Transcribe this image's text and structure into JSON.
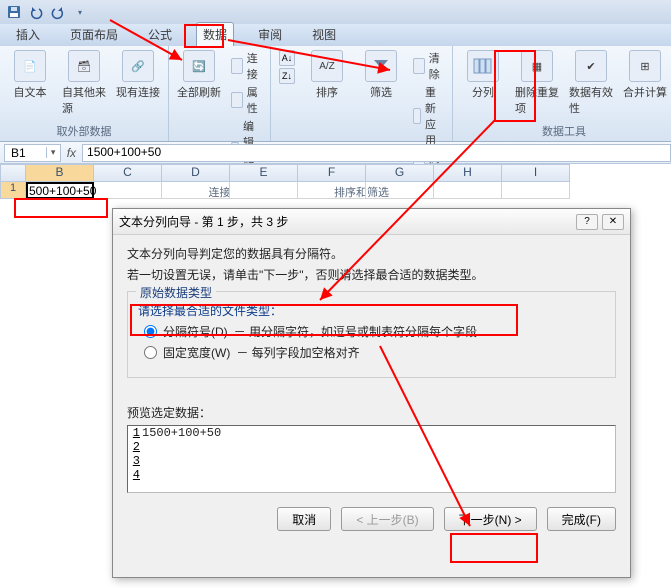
{
  "qat": {
    "save": "save",
    "undo": "undo",
    "redo": "redo"
  },
  "tabs": {
    "insert": "插入",
    "layout": "页面布局",
    "formulas": "公式",
    "data": "数据",
    "review": "审阅",
    "view": "视图"
  },
  "ribbon": {
    "ext": {
      "fromText": "自文本",
      "fromOther": "自其他来源",
      "existing": "现有连接",
      "title": "取外部数据"
    },
    "conn": {
      "refresh": "全部刷新",
      "connections": "连接",
      "properties": "属性",
      "editLinks": "编辑链接",
      "title": "连接"
    },
    "sort": {
      "sort": "排序",
      "filter": "筛选",
      "clear": "清除",
      "reapply": "重新应用",
      "advanced": "高级",
      "title": "排序和筛选"
    },
    "tools": {
      "textcol": "分列",
      "rmdup": "删除重复项",
      "validation": "数据有效性",
      "consolidate": "合并计算",
      "title": "数据工具"
    }
  },
  "namebox": "B1",
  "formula": "1500+100+50",
  "cols": [
    "B",
    "C",
    "D",
    "E",
    "F",
    "G",
    "H",
    "I"
  ],
  "row1": "1",
  "cellB1": "500+100+50",
  "dialog": {
    "title": "文本分列向导 - 第 1 步，共 3 步",
    "line1": "文本分列向导判定您的数据具有分隔符。",
    "line2": "若一切设置无误，请单击\"下一步\"，否则请选择最合适的数据类型。",
    "legend": "原始数据类型",
    "prompt": "请选择最合适的文件类型：",
    "opt1": "分隔符号(D)",
    "opt1desc": "－ 用分隔字符，如逗号或制表符分隔每个字段",
    "opt2": "固定宽度(W)",
    "opt2desc": "－ 每列字段加空格对齐",
    "previewLabel": "预览选定数据：",
    "previewData": "1500+100+50",
    "btnCancel": "取消",
    "btnBack": "< 上一步(B)",
    "btnNext": "下一步(N) >",
    "btnFinish": "完成(F)"
  }
}
